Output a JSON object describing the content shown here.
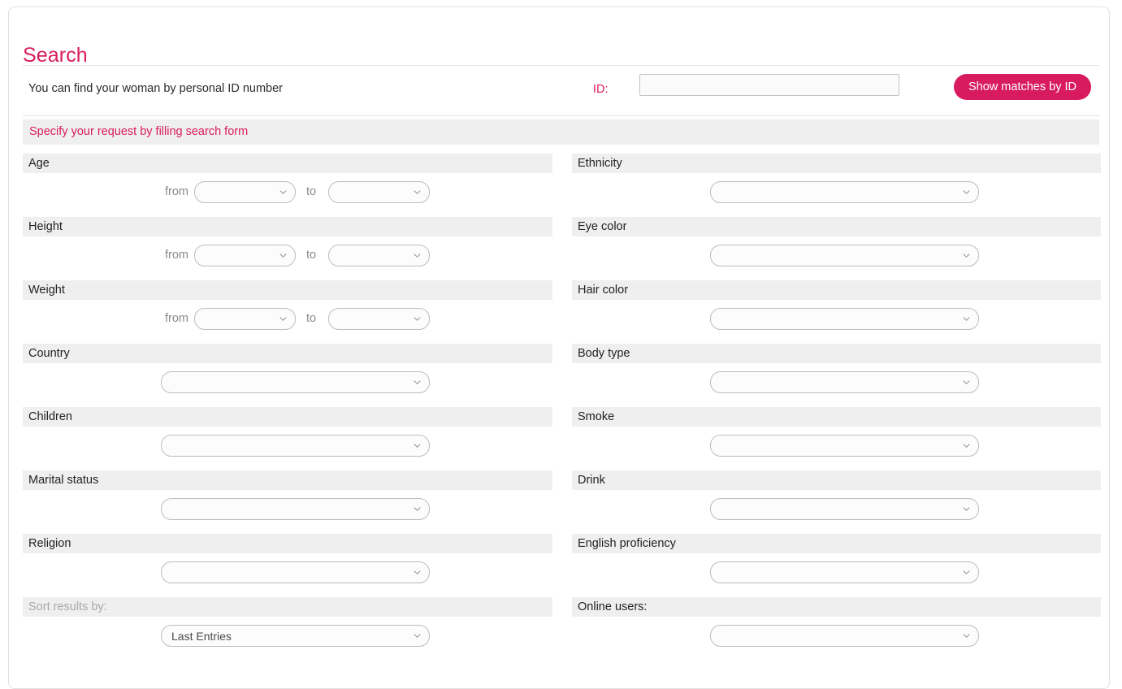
{
  "page": {
    "title": "Search",
    "accent_color": "#d81b5f",
    "band_color": "#efefef"
  },
  "id_search": {
    "hint": "You can find your woman by personal ID number",
    "id_label": "ID:",
    "id_value": "",
    "id_placeholder": "",
    "submit_label": "Show matches by ID"
  },
  "notice": {
    "text": "Specify your request by filling search form"
  },
  "range_labels": {
    "from": "from",
    "to": "to"
  },
  "left_column": [
    {
      "label": "Age",
      "type": "range",
      "from_value": "",
      "to_value": "",
      "muted": false
    },
    {
      "label": "Height",
      "type": "range",
      "from_value": "",
      "to_value": "",
      "muted": false
    },
    {
      "label": "Weight",
      "type": "range",
      "from_value": "",
      "to_value": "",
      "muted": false
    },
    {
      "label": "Country",
      "type": "select",
      "value": "",
      "muted": false
    },
    {
      "label": "Children",
      "type": "select",
      "value": "",
      "muted": false
    },
    {
      "label": "Marital status",
      "type": "select",
      "value": "",
      "muted": false
    },
    {
      "label": "Religion",
      "type": "select",
      "value": "",
      "muted": false
    },
    {
      "label": "Sort results by:",
      "type": "select",
      "value": "Last Entries",
      "muted": true
    }
  ],
  "right_column": [
    {
      "label": "Ethnicity",
      "type": "select",
      "value": "",
      "muted": false
    },
    {
      "label": "Eye color",
      "type": "select",
      "value": "",
      "muted": false
    },
    {
      "label": "Hair color",
      "type": "select",
      "value": "",
      "muted": false
    },
    {
      "label": "Body type",
      "type": "select",
      "value": "",
      "muted": false
    },
    {
      "label": "Smoke",
      "type": "select",
      "value": "",
      "muted": false
    },
    {
      "label": "Drink",
      "type": "select",
      "value": "",
      "muted": false
    },
    {
      "label": "English proficiency",
      "type": "select",
      "value": "",
      "muted": false
    },
    {
      "label": "Online users:",
      "type": "select",
      "value": "",
      "muted": false
    }
  ]
}
